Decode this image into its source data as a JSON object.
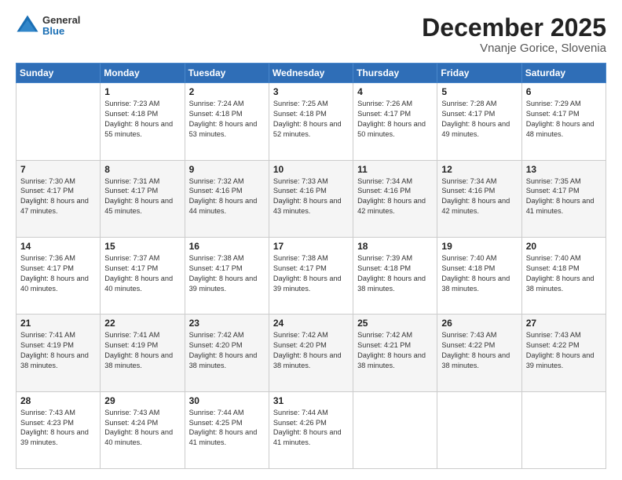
{
  "logo": {
    "general": "General",
    "blue": "Blue"
  },
  "header": {
    "month": "December 2025",
    "location": "Vnanje Gorice, Slovenia"
  },
  "weekdays": [
    "Sunday",
    "Monday",
    "Tuesday",
    "Wednesday",
    "Thursday",
    "Friday",
    "Saturday"
  ],
  "weeks": [
    [
      {
        "day": "",
        "sunrise": "",
        "sunset": "",
        "daylight": ""
      },
      {
        "day": "1",
        "sunrise": "7:23 AM",
        "sunset": "4:18 PM",
        "daylight": "8 hours and 55 minutes."
      },
      {
        "day": "2",
        "sunrise": "7:24 AM",
        "sunset": "4:18 PM",
        "daylight": "8 hours and 53 minutes."
      },
      {
        "day": "3",
        "sunrise": "7:25 AM",
        "sunset": "4:18 PM",
        "daylight": "8 hours and 52 minutes."
      },
      {
        "day": "4",
        "sunrise": "7:26 AM",
        "sunset": "4:17 PM",
        "daylight": "8 hours and 50 minutes."
      },
      {
        "day": "5",
        "sunrise": "7:28 AM",
        "sunset": "4:17 PM",
        "daylight": "8 hours and 49 minutes."
      },
      {
        "day": "6",
        "sunrise": "7:29 AM",
        "sunset": "4:17 PM",
        "daylight": "8 hours and 48 minutes."
      }
    ],
    [
      {
        "day": "7",
        "sunrise": "7:30 AM",
        "sunset": "4:17 PM",
        "daylight": "8 hours and 47 minutes."
      },
      {
        "day": "8",
        "sunrise": "7:31 AM",
        "sunset": "4:17 PM",
        "daylight": "8 hours and 45 minutes."
      },
      {
        "day": "9",
        "sunrise": "7:32 AM",
        "sunset": "4:16 PM",
        "daylight": "8 hours and 44 minutes."
      },
      {
        "day": "10",
        "sunrise": "7:33 AM",
        "sunset": "4:16 PM",
        "daylight": "8 hours and 43 minutes."
      },
      {
        "day": "11",
        "sunrise": "7:34 AM",
        "sunset": "4:16 PM",
        "daylight": "8 hours and 42 minutes."
      },
      {
        "day": "12",
        "sunrise": "7:34 AM",
        "sunset": "4:16 PM",
        "daylight": "8 hours and 42 minutes."
      },
      {
        "day": "13",
        "sunrise": "7:35 AM",
        "sunset": "4:17 PM",
        "daylight": "8 hours and 41 minutes."
      }
    ],
    [
      {
        "day": "14",
        "sunrise": "7:36 AM",
        "sunset": "4:17 PM",
        "daylight": "8 hours and 40 minutes."
      },
      {
        "day": "15",
        "sunrise": "7:37 AM",
        "sunset": "4:17 PM",
        "daylight": "8 hours and 40 minutes."
      },
      {
        "day": "16",
        "sunrise": "7:38 AM",
        "sunset": "4:17 PM",
        "daylight": "8 hours and 39 minutes."
      },
      {
        "day": "17",
        "sunrise": "7:38 AM",
        "sunset": "4:17 PM",
        "daylight": "8 hours and 39 minutes."
      },
      {
        "day": "18",
        "sunrise": "7:39 AM",
        "sunset": "4:18 PM",
        "daylight": "8 hours and 38 minutes."
      },
      {
        "day": "19",
        "sunrise": "7:40 AM",
        "sunset": "4:18 PM",
        "daylight": "8 hours and 38 minutes."
      },
      {
        "day": "20",
        "sunrise": "7:40 AM",
        "sunset": "4:18 PM",
        "daylight": "8 hours and 38 minutes."
      }
    ],
    [
      {
        "day": "21",
        "sunrise": "7:41 AM",
        "sunset": "4:19 PM",
        "daylight": "8 hours and 38 minutes."
      },
      {
        "day": "22",
        "sunrise": "7:41 AM",
        "sunset": "4:19 PM",
        "daylight": "8 hours and 38 minutes."
      },
      {
        "day": "23",
        "sunrise": "7:42 AM",
        "sunset": "4:20 PM",
        "daylight": "8 hours and 38 minutes."
      },
      {
        "day": "24",
        "sunrise": "7:42 AM",
        "sunset": "4:20 PM",
        "daylight": "8 hours and 38 minutes."
      },
      {
        "day": "25",
        "sunrise": "7:42 AM",
        "sunset": "4:21 PM",
        "daylight": "8 hours and 38 minutes."
      },
      {
        "day": "26",
        "sunrise": "7:43 AM",
        "sunset": "4:22 PM",
        "daylight": "8 hours and 38 minutes."
      },
      {
        "day": "27",
        "sunrise": "7:43 AM",
        "sunset": "4:22 PM",
        "daylight": "8 hours and 39 minutes."
      }
    ],
    [
      {
        "day": "28",
        "sunrise": "7:43 AM",
        "sunset": "4:23 PM",
        "daylight": "8 hours and 39 minutes."
      },
      {
        "day": "29",
        "sunrise": "7:43 AM",
        "sunset": "4:24 PM",
        "daylight": "8 hours and 40 minutes."
      },
      {
        "day": "30",
        "sunrise": "7:44 AM",
        "sunset": "4:25 PM",
        "daylight": "8 hours and 41 minutes."
      },
      {
        "day": "31",
        "sunrise": "7:44 AM",
        "sunset": "4:26 PM",
        "daylight": "8 hours and 41 minutes."
      },
      {
        "day": "",
        "sunrise": "",
        "sunset": "",
        "daylight": ""
      },
      {
        "day": "",
        "sunrise": "",
        "sunset": "",
        "daylight": ""
      },
      {
        "day": "",
        "sunrise": "",
        "sunset": "",
        "daylight": ""
      }
    ]
  ]
}
